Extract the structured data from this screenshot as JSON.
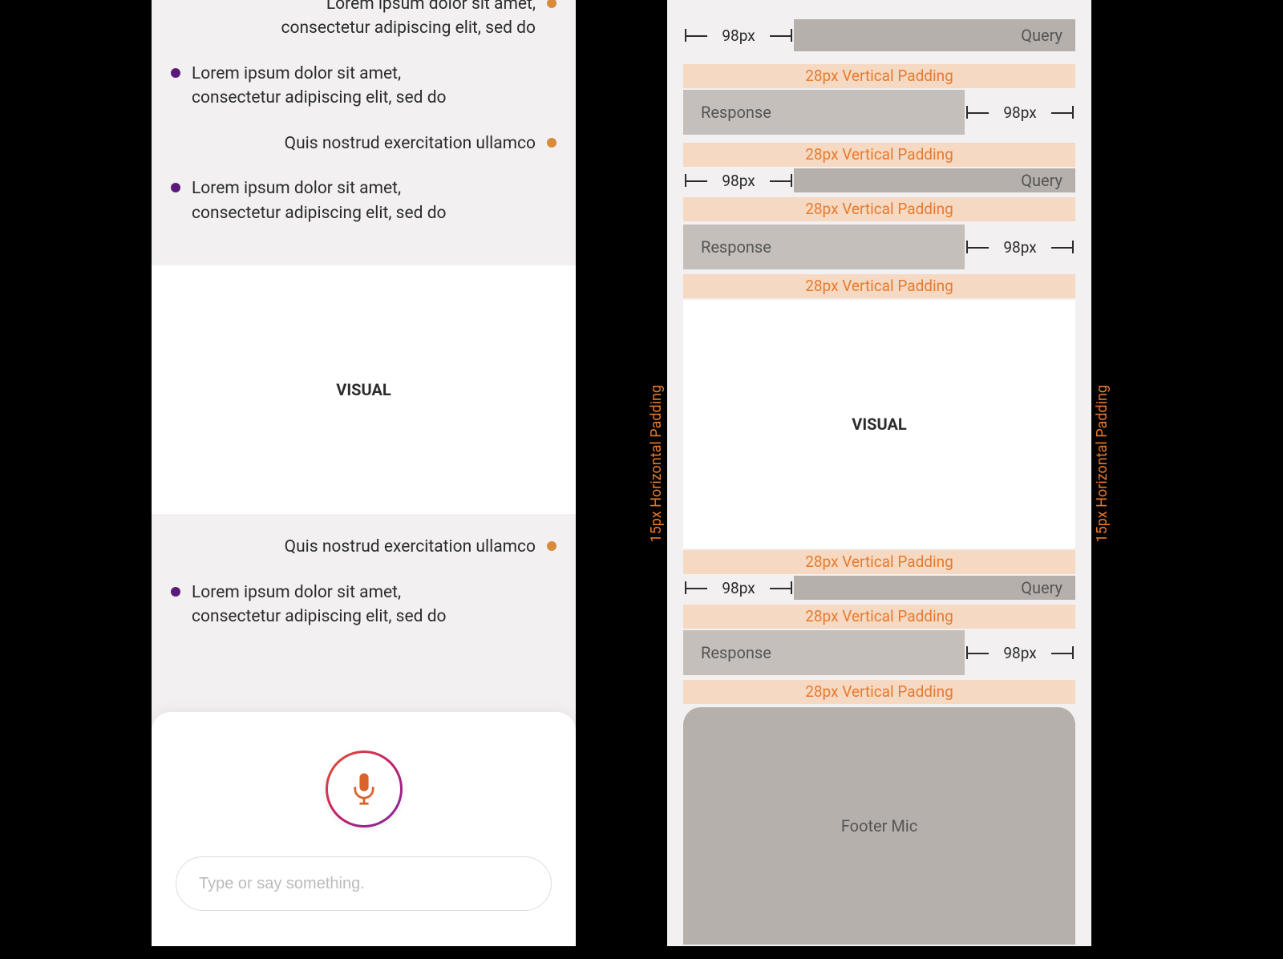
{
  "left": {
    "messages": [
      {
        "role": "query",
        "text": "Lorem ipsum dolor sit amet, consectetur adipiscing elit, sed do"
      },
      {
        "role": "response",
        "text": "Lorem ipsum dolor sit amet, consectetur adipiscing elit, sed do"
      },
      {
        "role": "query",
        "text": "Quis nostrud exercitation ullamco"
      },
      {
        "role": "response",
        "text": "Lorem ipsum dolor sit amet, consectetur adipiscing elit, sed do"
      }
    ],
    "visual_label": "VISUAL",
    "below_messages": [
      {
        "role": "query",
        "text": "Quis nostrud exercitation ullamco"
      },
      {
        "role": "response",
        "text": "Lorem ipsum dolor sit amet, consectetur adipiscing elit, sed do"
      }
    ],
    "input_placeholder": "Type or say something."
  },
  "right": {
    "hpad_label": "15px Horizontal Padding",
    "vpad_label": "28px Vertical Padding",
    "gap_label": "98px",
    "query_label": "Query",
    "response_label": "Response",
    "visual_label": "VISUAL",
    "footer_label": "Footer Mic"
  }
}
